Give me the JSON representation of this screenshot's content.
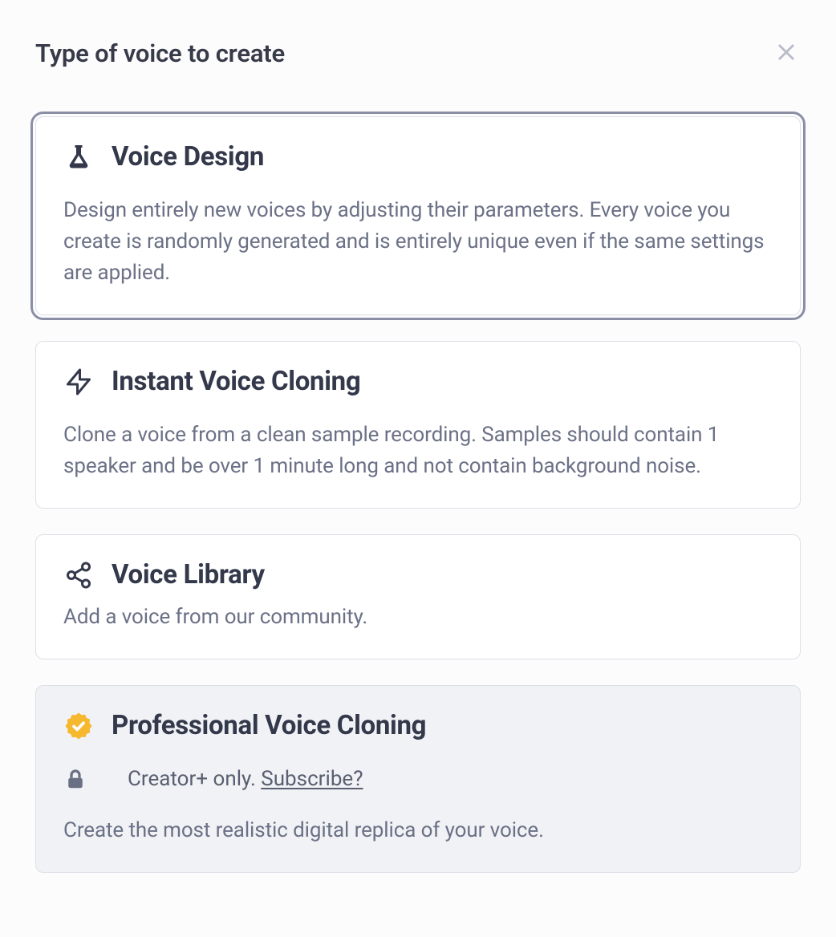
{
  "modal": {
    "title": "Type of voice to create"
  },
  "options": [
    {
      "id": "voice-design",
      "title": "Voice Design",
      "desc": "Design entirely new voices by adjusting their parameters. Every voice you create is randomly generated and is entirely unique even if the same settings are applied.",
      "selected": true,
      "locked": false
    },
    {
      "id": "instant-cloning",
      "title": "Instant Voice Cloning",
      "desc": "Clone a voice from a clean sample recording. Samples should contain 1 speaker and be over 1 minute long and not contain background noise.",
      "selected": false,
      "locked": false
    },
    {
      "id": "voice-library",
      "title": "Voice Library",
      "desc": "Add a voice from our community.",
      "selected": false,
      "locked": false
    },
    {
      "id": "professional-cloning",
      "title": "Professional Voice Cloning",
      "desc": "Create the most realistic digital replica of your voice.",
      "selected": false,
      "locked": true,
      "lock_label": "Creator+ only. ",
      "lock_link": "Subscribe?"
    }
  ]
}
